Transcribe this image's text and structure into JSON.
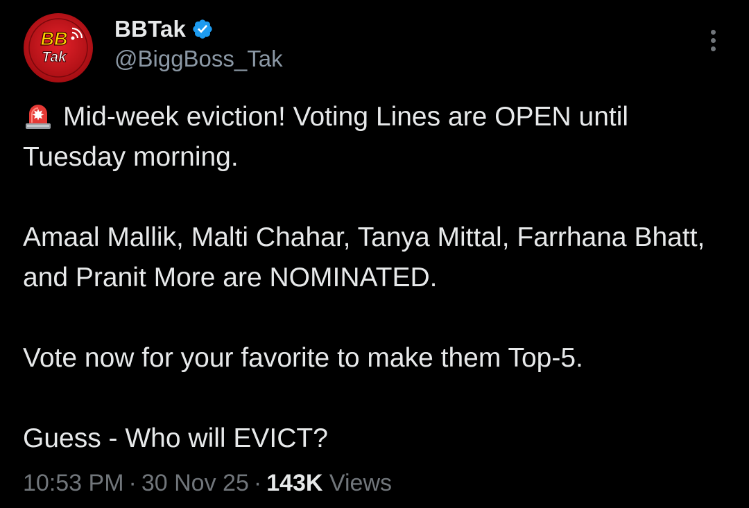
{
  "author": {
    "display_name": "BBTak",
    "handle": "@BiggBoss_Tak",
    "verified": true,
    "avatar_text": "BB",
    "avatar_subtext": "Tak"
  },
  "tweet": {
    "lines": [
      "Mid-week eviction! Voting Lines are OPEN until Tuesday morning.",
      "Amaal Mallik, Malti Chahar, Tanya Mittal, Farrhana Bhatt, and Pranit More are NOMINATED.",
      "Vote now for your favorite to make them Top-5.",
      "Guess - Who will EVICT?"
    ],
    "leading_icon": "police-siren-icon"
  },
  "meta": {
    "time": "10:53 PM",
    "separator": "·",
    "date": "30 Nov 25",
    "views_count": "143K",
    "views_label": "Views"
  },
  "colors": {
    "background": "#000000",
    "text": "#e7e9ea",
    "secondary": "#71767b",
    "verified": "#1d9bf0",
    "brand_red": "#d7141c",
    "brand_yellow": "#ffd400"
  },
  "icons": {
    "more": "more-vertical-icon",
    "verified": "verified-badge-icon"
  }
}
